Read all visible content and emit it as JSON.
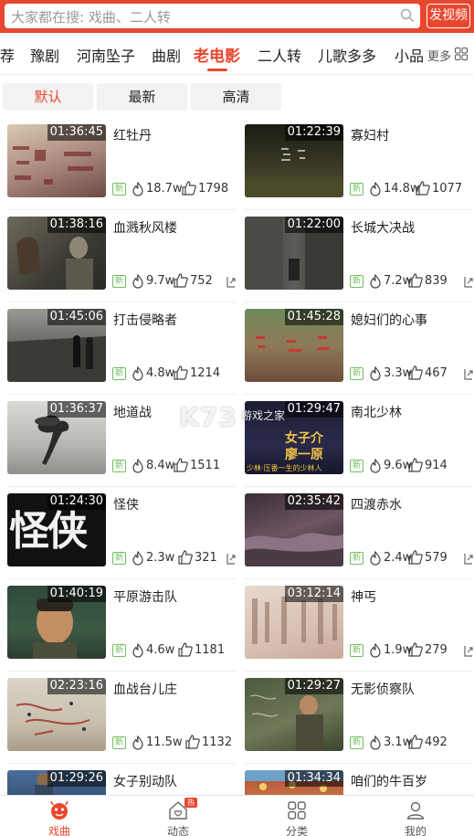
{
  "search": {
    "placeholder": "大家都在搜: 戏曲、二人转",
    "publish_label": "发视频"
  },
  "categories": [
    {
      "label": "荐"
    },
    {
      "label": "豫剧"
    },
    {
      "label": "河南坠子"
    },
    {
      "label": "曲剧"
    },
    {
      "label": "老电影",
      "active": true
    },
    {
      "label": "二人转"
    },
    {
      "label": "儿歌多多"
    },
    {
      "label": "小品"
    }
  ],
  "more_label": "更多",
  "sort": [
    {
      "label": "默认",
      "active": true
    },
    {
      "label": "最新"
    },
    {
      "label": "高清"
    }
  ],
  "videos": [
    {
      "title": "红牡丹",
      "duration": "01:36:45",
      "badge": "新",
      "views": "18.7w",
      "likes": "1798"
    },
    {
      "title": "寡妇村",
      "duration": "01:22:39",
      "badge": "新",
      "views": "14.8w",
      "likes": "1077"
    },
    {
      "title": "血溅秋风楼",
      "duration": "01:38:16",
      "badge": "新",
      "views": "9.7w",
      "likes": "752"
    },
    {
      "title": "长城大决战",
      "duration": "01:22:00",
      "badge": "新",
      "views": "7.2w",
      "likes": "839"
    },
    {
      "title": "打击侵略者",
      "duration": "01:45:06",
      "badge": "新",
      "views": "4.8w",
      "likes": "1214"
    },
    {
      "title": "媳妇们的心事",
      "duration": "01:45:28",
      "badge": "新",
      "views": "3.3w",
      "likes": "467"
    },
    {
      "title": "地道战",
      "duration": "01:36:37",
      "badge": "新",
      "views": "8.4w",
      "likes": "1511"
    },
    {
      "title": "南北少林",
      "duration": "01:29:47",
      "badge": "新",
      "views": "9.6w",
      "likes": "914"
    },
    {
      "title": "怪侠",
      "duration": "01:24:30",
      "badge": "新",
      "views": "2.3w",
      "likes": "321"
    },
    {
      "title": "四渡赤水",
      "duration": "02:35:42",
      "badge": "新",
      "views": "2.4w",
      "likes": "579"
    },
    {
      "title": "平原游击队",
      "duration": "01:40:19",
      "badge": "新",
      "views": "4.6w",
      "likes": "1181"
    },
    {
      "title": "神丐",
      "duration": "03:12:14",
      "badge": "新",
      "views": "1.9w",
      "likes": "279"
    },
    {
      "title": "血战台儿庄",
      "duration": "02:23:16",
      "badge": "新",
      "views": "11.5w",
      "likes": "1132"
    },
    {
      "title": "无影侦察队",
      "duration": "01:29:27",
      "badge": "新",
      "views": "3.1w",
      "likes": "492"
    },
    {
      "title": "女子别动队",
      "duration": "01:29:26"
    },
    {
      "title": "咱们的牛百岁",
      "duration": "01:34:34"
    }
  ],
  "thumb_text": {
    "huaizi": "怪侠",
    "nanbei_1": "女子介",
    "nanbei_2": "廖一原",
    "nanbei_3": "少林·压番一生的少林人"
  },
  "watermark": {
    "logo": "K73",
    "site": "游戏之家"
  },
  "tabs": [
    {
      "label": "戏曲",
      "active": true,
      "icon": "opera-icon"
    },
    {
      "label": "动态",
      "icon": "home-icon",
      "badge": "热"
    },
    {
      "label": "分类",
      "icon": "category-icon"
    },
    {
      "label": "我的",
      "icon": "user-icon"
    }
  ],
  "colors": {
    "accent": "#e8472f",
    "new_badge": "#6fbf5f"
  }
}
